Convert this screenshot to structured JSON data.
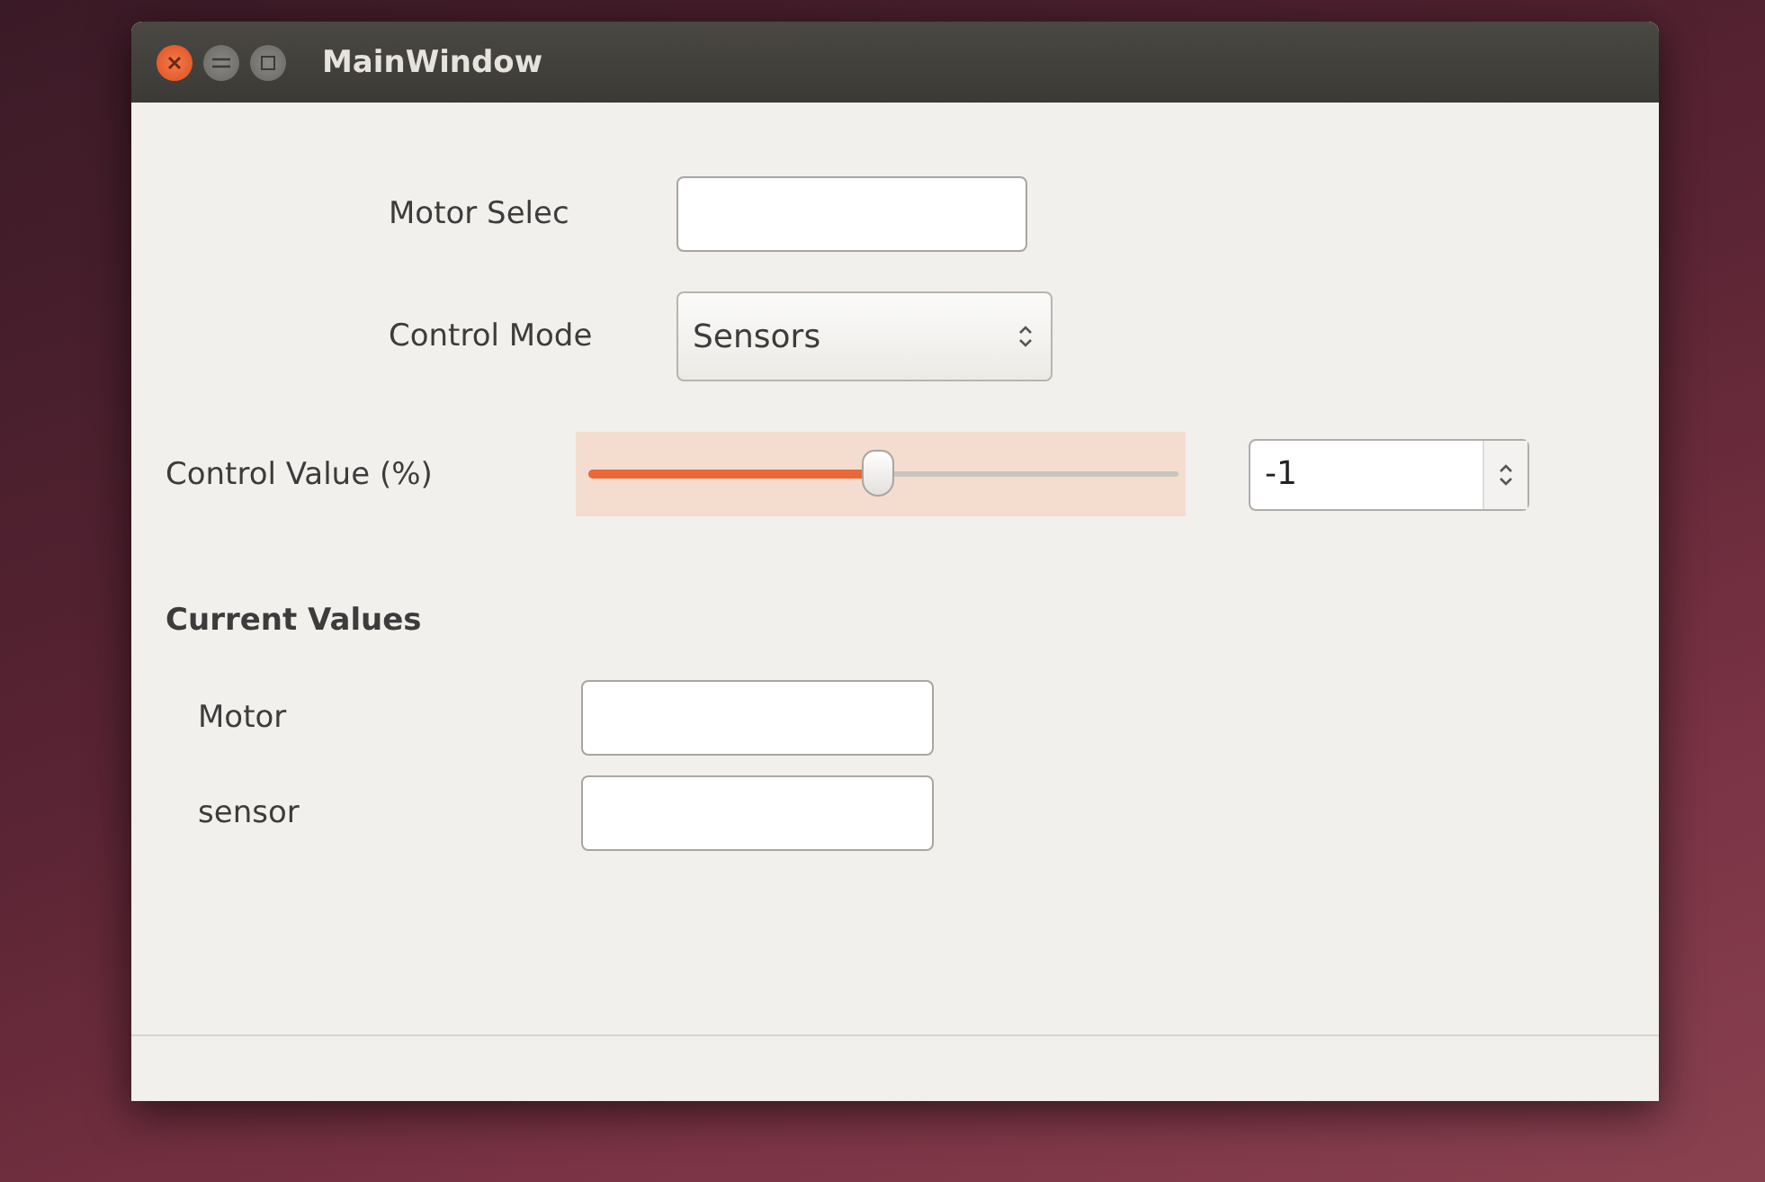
{
  "window": {
    "title": "MainWindow"
  },
  "motor_select": {
    "label": "Motor Selec"
  },
  "control_mode": {
    "label": "Control Mode",
    "value": "Sensors"
  },
  "control_value": {
    "label": "Control Value (%)",
    "level": 0.49,
    "focused": true,
    "value": "-1"
  },
  "current_values": {
    "title": "Current Values",
    "rows": [
      {
        "label": "Motor"
      },
      {
        "label": "sensor"
      }
    ]
  }
}
